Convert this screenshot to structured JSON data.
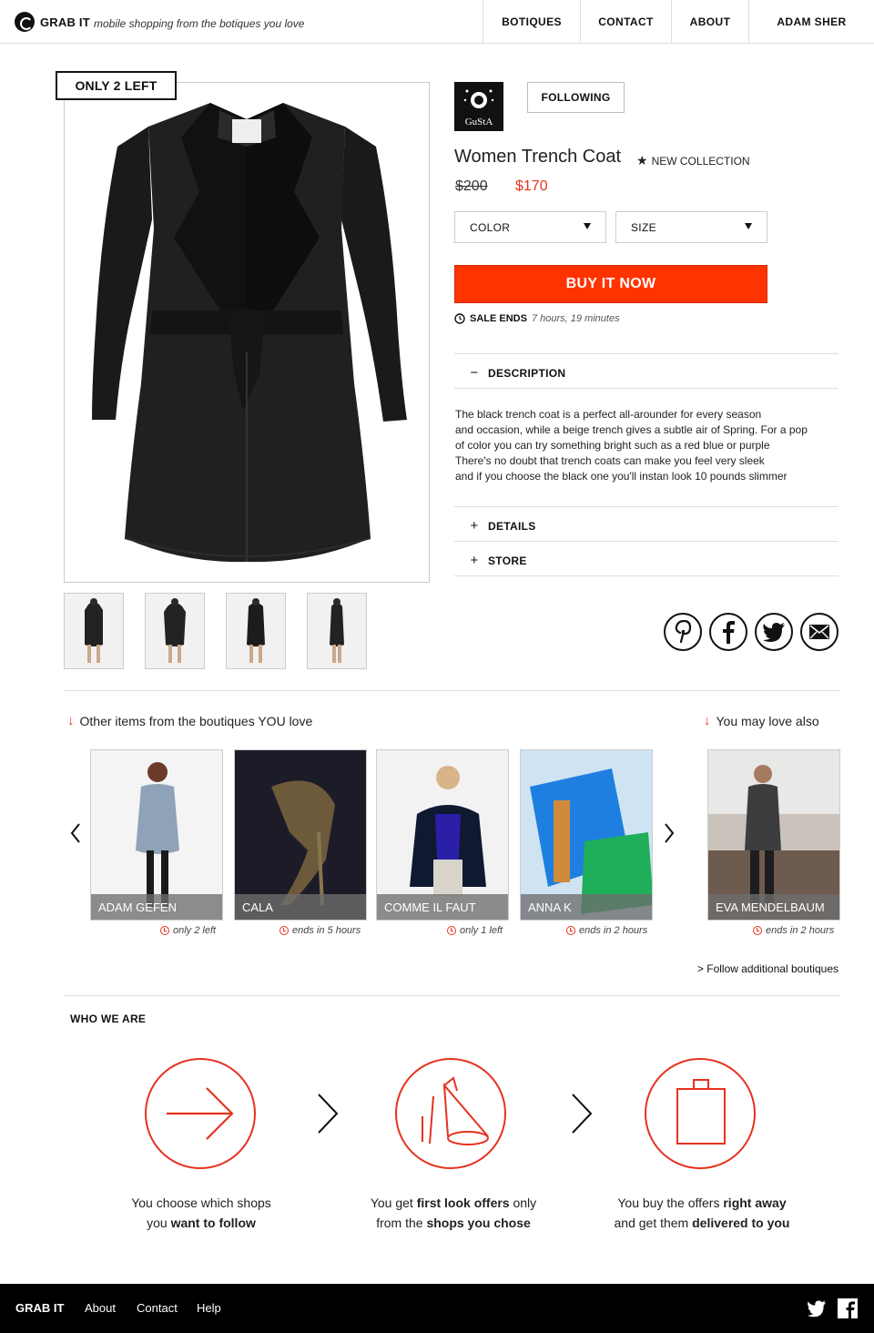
{
  "header": {
    "brand": "GRAB IT",
    "tagline": "mobile shopping from the botiques you love",
    "nav": [
      "BOTIQUES",
      "CONTACT",
      "ABOUT",
      "ADAM SHER"
    ]
  },
  "product": {
    "stock_badge": "ONLY 2 LEFT",
    "store_logo_text": "GuStA",
    "follow_label": "FOLLOWING",
    "title": "Women Trench Coat",
    "collection": "NEW COLLECTION",
    "old_price": "$200",
    "new_price": "$170",
    "color_label": "COLOR",
    "size_label": "SIZE",
    "buy_label": "BUY IT NOW",
    "sale_ends_label": "SALE ENDS",
    "sale_ends_time": "7 hours, 19 minutes",
    "accordion": {
      "description": "DESCRIPTION",
      "details": "DETAILS",
      "store": "STORE"
    },
    "description_lines": [
      "The black trench coat is a perfect all-arounder for every season",
      "and occasion, while a beige trench gives a subtle air of Spring. For a pop",
      "of color you can try something bright such as a red blue or purple",
      "There's no doubt that trench coats can make you feel very sleek",
      "and if you choose the black one you'll instan look 10 pounds slimmer"
    ]
  },
  "share": [
    "pinterest-icon",
    "facebook-icon",
    "twitter-icon",
    "mail-icon"
  ],
  "sections": {
    "other_items": "Other items from the boutiques YOU love",
    "you_may_love": "You may love also",
    "follow_more": "> Follow additional boutiques"
  },
  "items": [
    {
      "name": "ADAM GEFEN",
      "status": "only 2 left"
    },
    {
      "name": "CALA",
      "status": "ends in 5 hours"
    },
    {
      "name": "COMME IL FAUT",
      "status": "only 1 left"
    },
    {
      "name": "ANNA K",
      "status": "ends in 2 hours"
    },
    {
      "name": "EVA MENDELBAUM",
      "status": "ends in 2 hours"
    }
  ],
  "who": {
    "title": "WHO WE ARE",
    "steps": [
      {
        "l1a": "You choose which shops",
        "l2a": "you ",
        "l2b": "want to follow",
        "l2c": ""
      },
      {
        "l1a": "You get ",
        "l1b": "first look offers",
        "l1c": " only",
        "l2a": "from the ",
        "l2b": "shops you chose",
        "l2c": ""
      },
      {
        "l1a": "You buy the offers ",
        "l1b": "right away",
        "l1c": "",
        "l2a": "and get them ",
        "l2b": "delivered to you",
        "l2c": ""
      }
    ]
  },
  "footer": {
    "brand": "GRAB IT",
    "links": [
      "About",
      "Contact",
      "Help"
    ]
  },
  "colors": {
    "accent": "#ff3300",
    "price_red": "#e6321f"
  }
}
